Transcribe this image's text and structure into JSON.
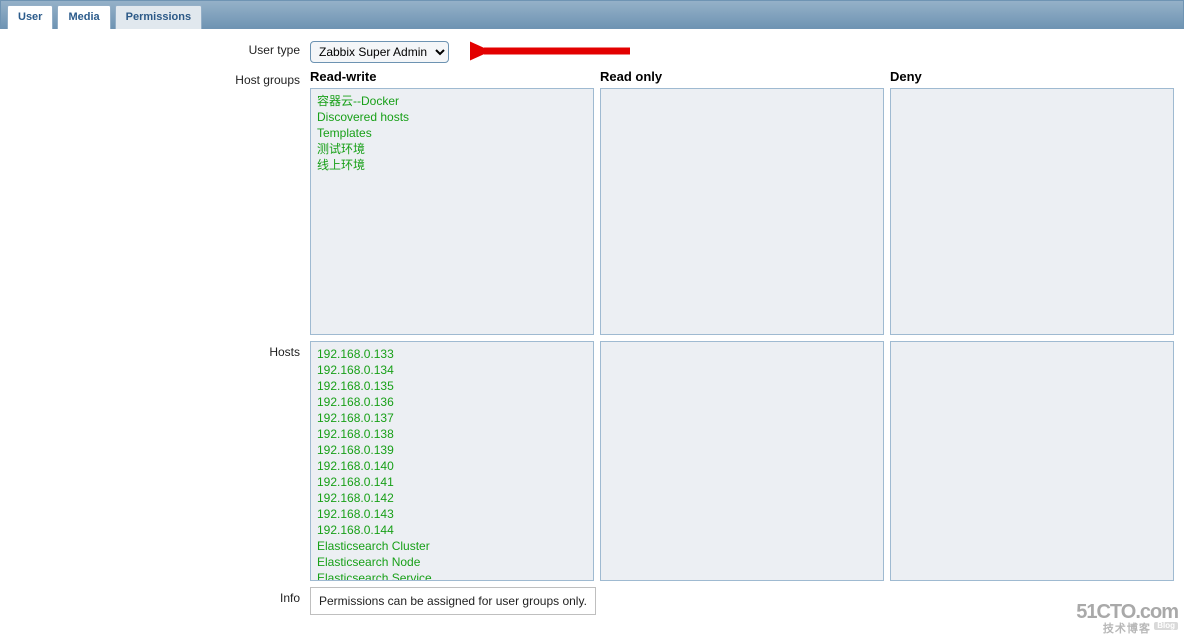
{
  "tabs": {
    "user": "User",
    "media": "Media",
    "permissions": "Permissions"
  },
  "labels": {
    "user_type": "User type",
    "host_groups": "Host groups",
    "hosts": "Hosts",
    "info": "Info"
  },
  "user_type_select": {
    "value": "Zabbix Super Admin"
  },
  "perm_columns": {
    "read_write": "Read-write",
    "read_only": "Read only",
    "deny": "Deny"
  },
  "host_groups": {
    "read_write": [
      "容器云--Docker",
      "Discovered hosts",
      "Templates",
      "测试环境",
      "线上环境"
    ],
    "read_only": [],
    "deny": []
  },
  "hosts": {
    "read_write": [
      "192.168.0.133",
      "192.168.0.134",
      "192.168.0.135",
      "192.168.0.136",
      "192.168.0.137",
      "192.168.0.138",
      "192.168.0.139",
      "192.168.0.140",
      "192.168.0.141",
      "192.168.0.142",
      "192.168.0.143",
      "192.168.0.144",
      "Elasticsearch Cluster",
      "Elasticsearch Node",
      "Elasticsearch Service"
    ],
    "read_only": [],
    "deny": []
  },
  "info_text": "Permissions can be assigned for user groups only.",
  "watermark": {
    "line1": "51CTO.com",
    "line2": "技术博客",
    "badge": "Blog"
  }
}
